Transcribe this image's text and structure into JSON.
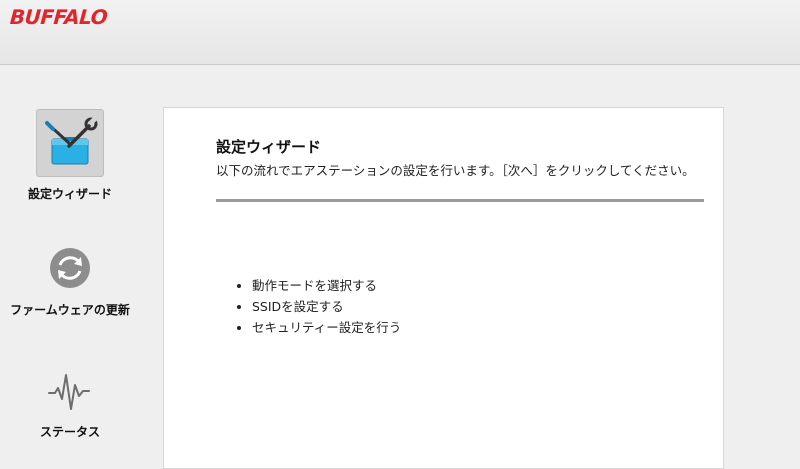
{
  "header": {
    "logo_text": "BUFFALO",
    "brand_color": "#e0262b"
  },
  "sidebar": {
    "items": [
      {
        "label": "設定ウィザード",
        "icon": "toolbox-icon",
        "active": true
      },
      {
        "label": "ファームウェアの更新",
        "icon": "refresh-icon",
        "active": false
      },
      {
        "label": "ステータス",
        "icon": "pulse-icon",
        "active": false
      }
    ]
  },
  "main": {
    "title": "設定ウィザード",
    "description": "以下の流れでエアステーションの設定を行います。［次へ］をクリックしてください。",
    "steps": [
      "動作モードを選択する",
      "SSIDを設定する",
      "セキュリティー設定を行う"
    ]
  }
}
